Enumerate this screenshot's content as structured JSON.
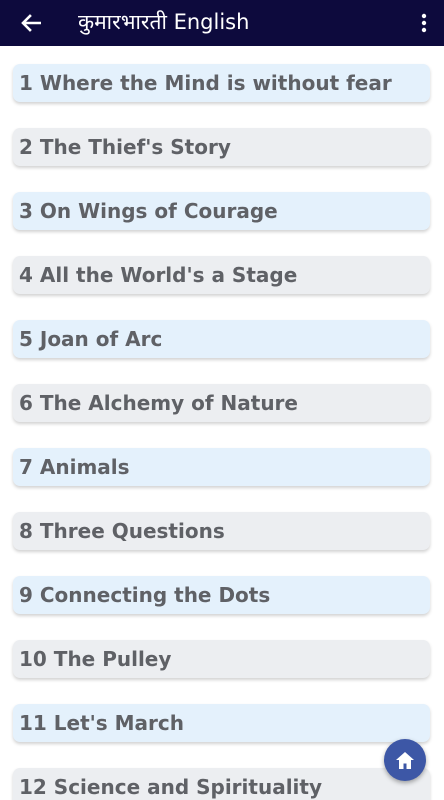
{
  "header": {
    "title": "कुमारभारती English",
    "back_icon": "arrow-left-icon",
    "menu_icon": "more-vertical-icon",
    "background": "#0d0a3d"
  },
  "chapters": [
    "1 Where the Mind is without fear",
    "2 The Thief's Story",
    "3 On Wings of Courage",
    "4 All the World's a Stage",
    "5 Joan of Arc",
    "6 The Alchemy of Nature",
    "7 Animals",
    "8 Three Questions",
    "9 Connecting the Dots",
    "10 The Pulley",
    "11 Let's March",
    "12 Science and Spirituality"
  ],
  "colors": {
    "item_blue": "#e4f1fc",
    "item_gray": "#eceef1",
    "fab": "#3d57a6"
  },
  "fab": {
    "icon": "home-icon"
  }
}
